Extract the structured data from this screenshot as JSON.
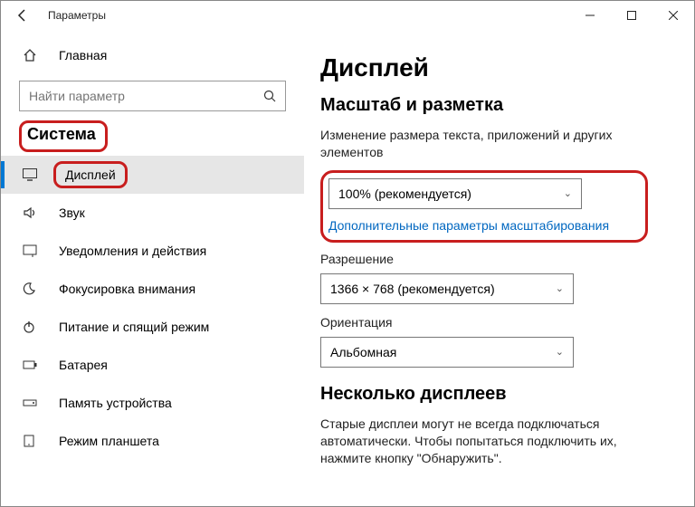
{
  "window": {
    "title": "Параметры"
  },
  "sidebar": {
    "home_label": "Главная",
    "search_placeholder": "Найти параметр",
    "category": "Система",
    "items": [
      {
        "label": "Дисплей",
        "selected": true
      },
      {
        "label": "Звук"
      },
      {
        "label": "Уведомления и действия"
      },
      {
        "label": "Фокусировка внимания"
      },
      {
        "label": "Питание и спящий режим"
      },
      {
        "label": "Батарея"
      },
      {
        "label": "Память устройства"
      },
      {
        "label": "Режим планшета"
      }
    ]
  },
  "main": {
    "heading": "Дисплей",
    "scale_section": "Масштаб и разметка",
    "scale_desc": "Изменение размера текста, приложений и других элементов",
    "scale_value": "100% (рекомендуется)",
    "scale_link": "Дополнительные параметры масштабирования",
    "resolution_label": "Разрешение",
    "resolution_value": "1366 × 768 (рекомендуется)",
    "orientation_label": "Ориентация",
    "orientation_value": "Альбомная",
    "multi_heading": "Несколько дисплеев",
    "multi_desc": "Старые дисплеи могут не всегда подключаться автоматически. Чтобы попытаться подключить их, нажмите кнопку \"Обнаружить\"."
  }
}
